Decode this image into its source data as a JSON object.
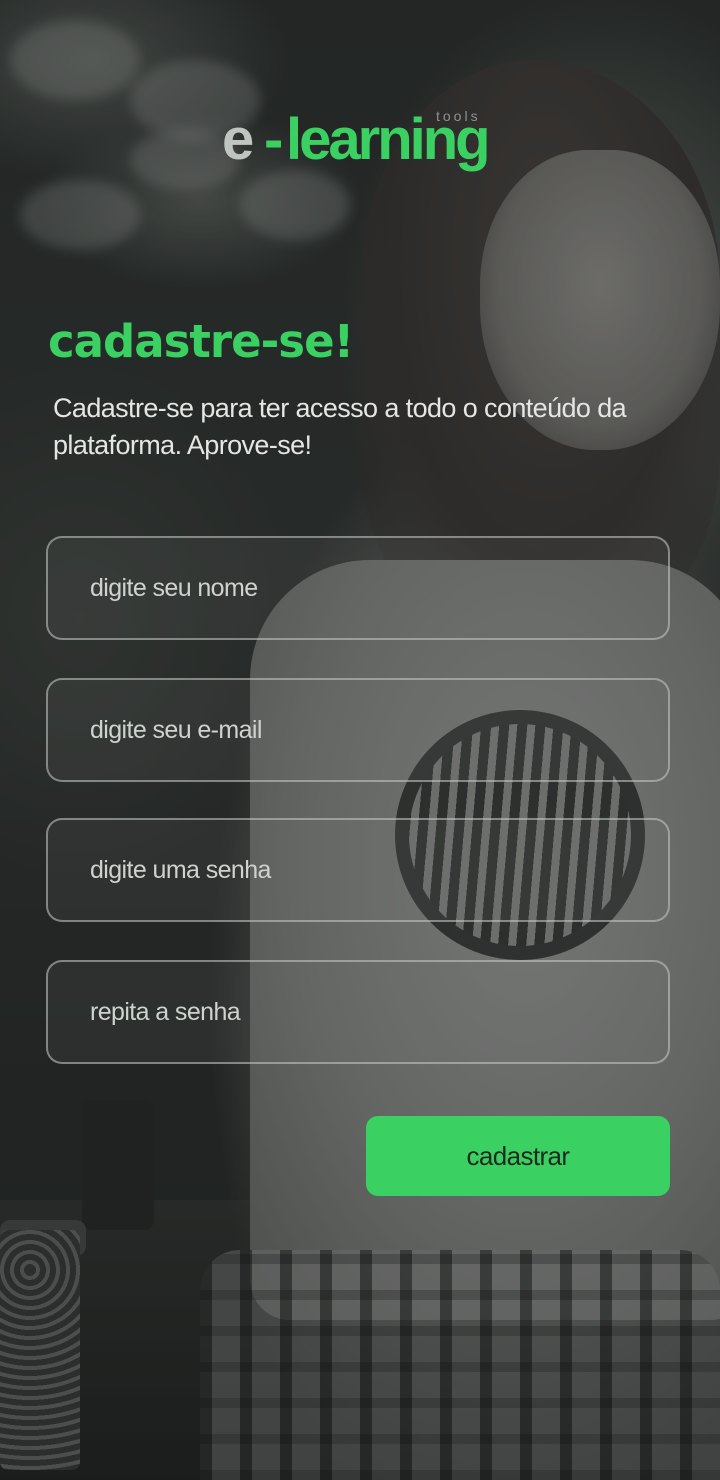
{
  "brand": {
    "prefix": "e",
    "dash": "-",
    "name": "learning",
    "tag": "tools",
    "accent_color": "#3ad162"
  },
  "heading": "cadastre-se!",
  "description": "Cadastre-se para ter acesso a todo o conteúdo da plataforma. Aprove-se!",
  "form": {
    "name_placeholder": "digite seu nome",
    "email_placeholder": "digite seu e-mail",
    "password_placeholder": "digite uma senha",
    "repeat_password_placeholder": "repita a senha",
    "submit_label": "cadastrar"
  }
}
